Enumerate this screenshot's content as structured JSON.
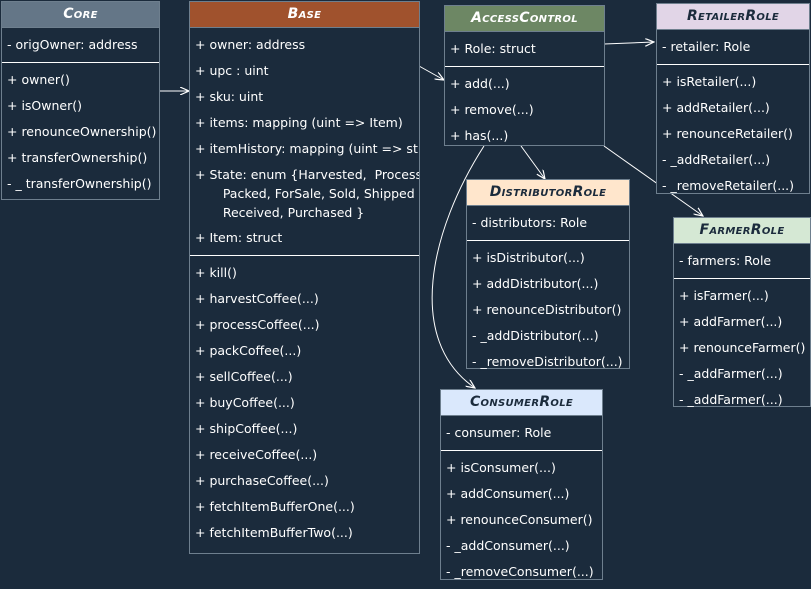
{
  "core": {
    "title": "Core",
    "attributes": [
      "- origOwner: address"
    ],
    "methods": [
      "+ owner()",
      "+ isOwner()",
      "+ renounceOwnership()",
      "+ transferOwnership()",
      "- _ transferOwnership()"
    ]
  },
  "base": {
    "title": "Base",
    "attributes": [
      "+ owner: address",
      "+ upc : uint",
      "+ sku: uint",
      "+ items: mapping (uint => Item)",
      "+ itemHistory: mapping (uint => string",
      "+ State: enum {Harvested,  Processed,\n       Packed, ForSale, Sold, Shipped\n       Received, Purchased }",
      "+ Item: struct"
    ],
    "methods": [
      "+ kill()",
      "+ harvestCoffee(...)",
      "+ processCoffee(...)",
      "+ packCoffee(...)",
      "+ sellCoffee(...)",
      "+ buyCoffee(...)",
      "+ shipCoffee(...)",
      "+ receiveCoffee(...)",
      "+ purchaseCoffee(...)",
      "+ fetchItemBufferOne(...)",
      "+ fetchItemBufferTwo(...)"
    ]
  },
  "access": {
    "title": "AccessControl",
    "attributes": [
      "+ Role: struct"
    ],
    "methods": [
      "+ add(...)",
      "+ remove(...)",
      "+ has(...)"
    ]
  },
  "retailer": {
    "title": "RetailerRole",
    "attributes": [
      "- retailer: Role"
    ],
    "methods": [
      "+ isRetailer(...)",
      "+ addRetailer(...)",
      "+ renounceRetailer()",
      "- _addRetailer(...)",
      "- _removeRetailer(...)"
    ]
  },
  "distributor": {
    "title": "DistributorRole",
    "attributes": [
      "- distributors: Role"
    ],
    "methods": [
      "+ isDistributor(...)",
      "+ addDistributor(...)",
      "+ renounceDistributor()",
      "- _addDistributor(...)",
      "- _removeDistributor(...)"
    ]
  },
  "farmer": {
    "title": "FarmerRole",
    "attributes": [
      "- farmers: Role"
    ],
    "methods": [
      "+ isFarmer(...)",
      "+ addFarmer(...)",
      "+ renounceFarmer()",
      "- _addFarmer(...)",
      "- _addFarmer(...)"
    ]
  },
  "consumer": {
    "title": "ConsumerRole",
    "attributes": [
      "- consumer: Role"
    ],
    "methods": [
      "+ isConsumer(...)",
      "+ addConsumer(...)",
      "+ renounceConsumer()",
      "- _addConsumer(...)",
      "- _removeConsumer(...)"
    ]
  },
  "colors": {
    "background": "#1b2b3c",
    "line": "#ffffff",
    "core_header": "#647687",
    "base_header": "#a0522d",
    "access_header": "#6d8764",
    "retailer_header": "#e1d5e7",
    "distributor_header": "#ffe6cc",
    "farmer_header": "#d5e8d4",
    "consumer_header": "#dae8fc"
  }
}
